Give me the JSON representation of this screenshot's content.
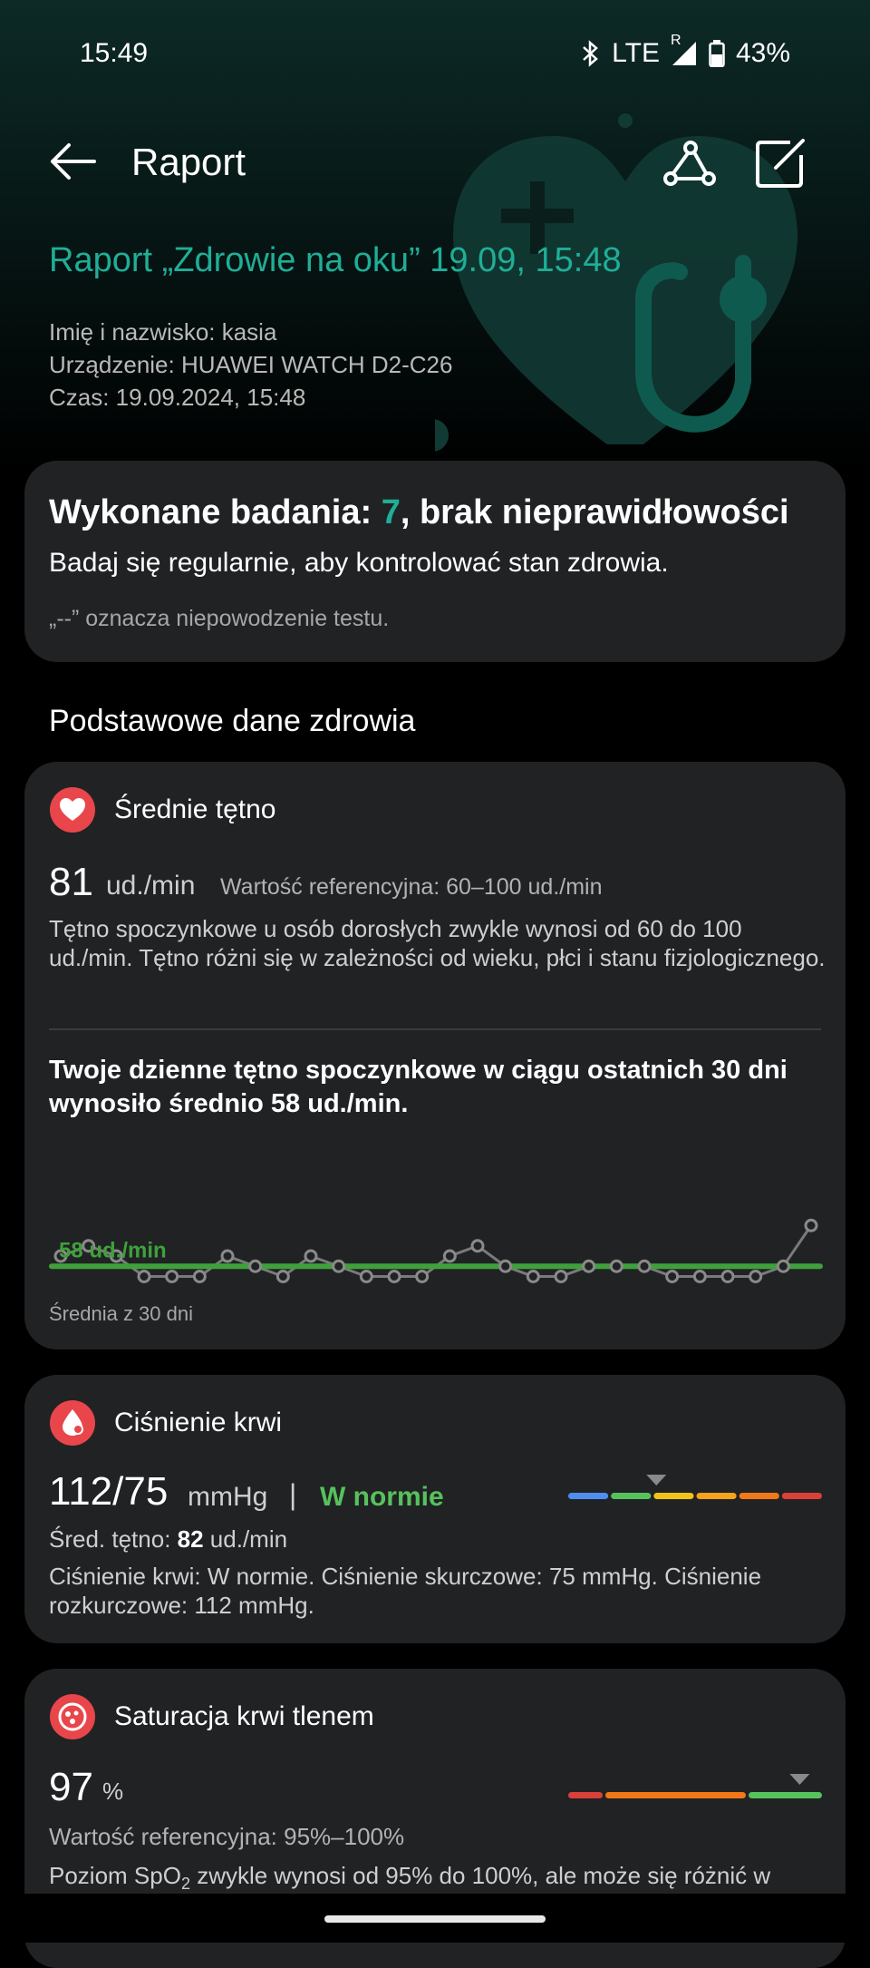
{
  "status_bar": {
    "time": "15:49",
    "network": "LTE",
    "roaming": "R",
    "battery": "43%"
  },
  "header": {
    "title": "Raport"
  },
  "report": {
    "title": "Raport „Zdrowie na oku” 19.09, 15:48",
    "name_line": "Imię i nazwisko: kasia",
    "device_line": "Urządzenie: HUAWEI WATCH D2-C26",
    "time_line": "Czas: 19.09.2024, 15:48"
  },
  "summary": {
    "title_prefix": "Wykonane badania: ",
    "count": "7",
    "title_suffix": ", brak nieprawidłowości",
    "subtitle": "Badaj się regularnie, aby kontrolować stan zdrowia.",
    "note": "„--” oznacza niepowodzenie testu."
  },
  "section_title": "Podstawowe dane zdrowia",
  "heart_rate": {
    "title": "Średnie tętno",
    "value": "81",
    "unit": "ud./min",
    "reference": "Wartość referencyjna: 60–100 ud./min",
    "description": "Tętno spoczynkowe u osób dorosłych zwykle wynosi od 60 do 100 ud./min. Tętno różni się w zależności od wieku, płci i stanu fizjologicznego.",
    "resting_summary": "Twoje dzienne tętno spoczynkowe w ciągu ostatnich 30 dni wynosiło średnio 58 ud./min.",
    "avg_label": "58 ud./min",
    "avg_note": "Średnia z 30 dni"
  },
  "chart_data": {
    "type": "line",
    "title": "",
    "xlabel": "",
    "ylabel": "",
    "average": 58,
    "series": [
      {
        "values": [
          59,
          60,
          59,
          57,
          57,
          57,
          59,
          58,
          57,
          59,
          58,
          57,
          57,
          57,
          59,
          60,
          58,
          57,
          57,
          58,
          58,
          58,
          57,
          57,
          57,
          57,
          58,
          62
        ]
      }
    ]
  },
  "blood_pressure": {
    "title": "Ciśnienie krwi",
    "value": "112/75",
    "unit": "mmHg",
    "separator": "|",
    "status": "W normie",
    "pulse_label": "Śred. tętno: ",
    "pulse_value": "82",
    "pulse_unit": " ud./min",
    "description": "Ciśnienie krwi: W normie. Ciśnienie skurczowe: 75 mmHg. Ciśnienie rozkurczowe: 112 mmHg.",
    "scale_colors": [
      "#4f8ef0",
      "#56c25c",
      "#f2c21b",
      "#f5a21d",
      "#f07818",
      "#d9403a"
    ],
    "marker_segment": 1
  },
  "spo2": {
    "title": "Saturacja krwi tlenem",
    "value": "97",
    "unit": "%",
    "reference": "Wartość referencyjna: 95%–100%",
    "description_pre": "Poziom SpO",
    "description_sub": "2",
    "description_post": " zwykle wynosi od 95% do 100%, ale może się różnić w",
    "scale_colors": [
      "#d9403a",
      "#f07818",
      "#56c25c"
    ]
  },
  "colors": {
    "accent": "#1fae97",
    "normal": "#56c25c",
    "card": "#212224"
  }
}
